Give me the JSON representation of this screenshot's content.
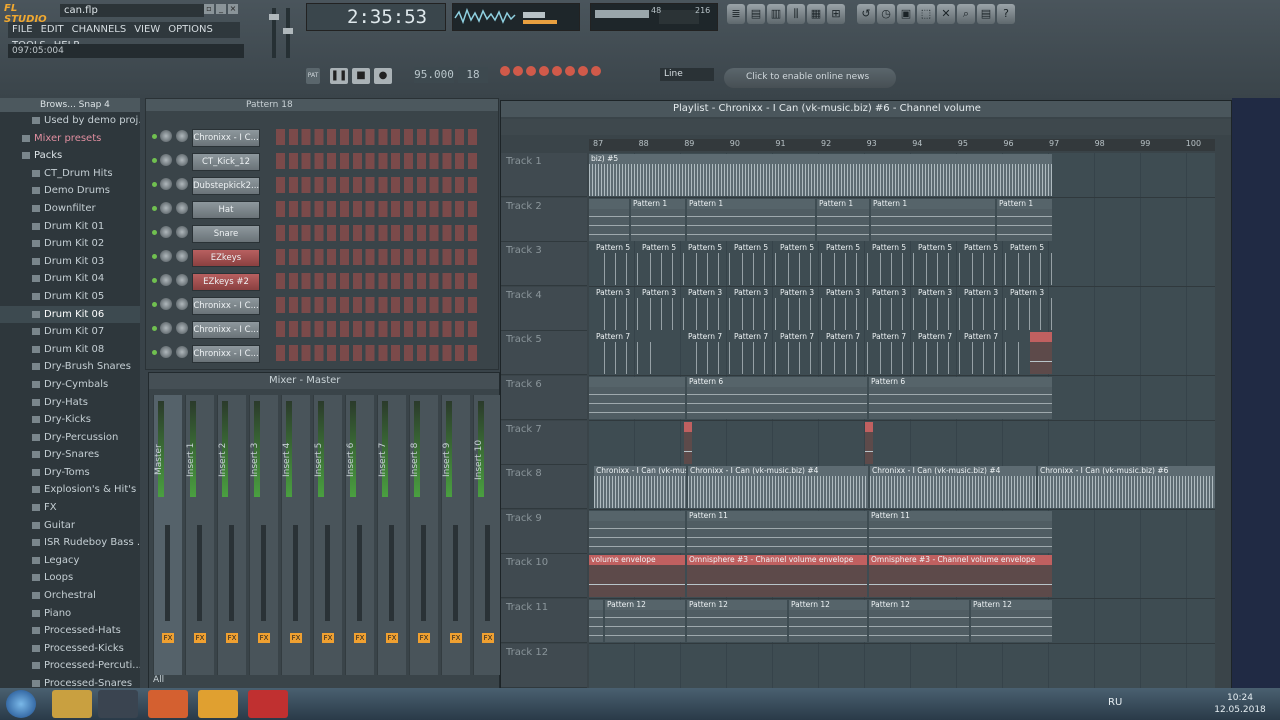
{
  "app": {
    "logo_text": "FL STUDIO",
    "file_name": "can.flp"
  },
  "menu": [
    "FILE",
    "EDIT",
    "CHANNELS",
    "VIEW",
    "OPTIONS",
    "TOOLS",
    "HELP"
  ],
  "hint_text": "097:05:004",
  "time_display": "2:35:53",
  "tempo": "95.000",
  "pattern_number": "18",
  "cpu_readout": {
    "cpu": "48",
    "poly": "216"
  },
  "snap_mode": "Line",
  "online_text": "Click to enable online news",
  "browser": {
    "title": "Brows... Snap 4",
    "items": [
      {
        "label": "Used by demo proj...",
        "kind": "item"
      },
      {
        "label": "Mixer presets",
        "kind": "mix"
      },
      {
        "label": "Packs",
        "kind": "packs"
      },
      {
        "label": "CT_Drum Hits",
        "kind": "item"
      },
      {
        "label": "Demo Drums",
        "kind": "item"
      },
      {
        "label": "Downfilter",
        "kind": "item"
      },
      {
        "label": "Drum Kit 01",
        "kind": "item"
      },
      {
        "label": "Drum Kit 02",
        "kind": "item"
      },
      {
        "label": "Drum Kit 03",
        "kind": "item"
      },
      {
        "label": "Drum Kit 04",
        "kind": "item"
      },
      {
        "label": "Drum Kit 05",
        "kind": "item"
      },
      {
        "label": "Drum Kit 06",
        "kind": "sel"
      },
      {
        "label": "Drum Kit 07",
        "kind": "item"
      },
      {
        "label": "Drum Kit 08",
        "kind": "item"
      },
      {
        "label": "Dry-Brush Snares",
        "kind": "item"
      },
      {
        "label": "Dry-Cymbals",
        "kind": "item"
      },
      {
        "label": "Dry-Hats",
        "kind": "item"
      },
      {
        "label": "Dry-Kicks",
        "kind": "item"
      },
      {
        "label": "Dry-Percussion",
        "kind": "item"
      },
      {
        "label": "Dry-Snares",
        "kind": "item"
      },
      {
        "label": "Dry-Toms",
        "kind": "item"
      },
      {
        "label": "Explosion's & Hit's",
        "kind": "item"
      },
      {
        "label": "FX",
        "kind": "item"
      },
      {
        "label": "Guitar",
        "kind": "item"
      },
      {
        "label": "ISR Rudeboy Bass ...",
        "kind": "item"
      },
      {
        "label": "Legacy",
        "kind": "item"
      },
      {
        "label": "Loops",
        "kind": "item"
      },
      {
        "label": "Orchestral",
        "kind": "item"
      },
      {
        "label": "Piano",
        "kind": "item"
      },
      {
        "label": "Processed-Hats",
        "kind": "item"
      },
      {
        "label": "Processed-Kicks",
        "kind": "item"
      },
      {
        "label": "Processed-Percuti...",
        "kind": "item"
      },
      {
        "label": "Processed-Snares",
        "kind": "item"
      }
    ]
  },
  "channel_rack": {
    "title": "Pattern 18",
    "channels": [
      {
        "name": "Chronixx - I C...",
        "color": "grey"
      },
      {
        "name": "CT_Kick_12",
        "color": "grey"
      },
      {
        "name": "Dubstepkick2...",
        "color": "grey"
      },
      {
        "name": "Hat",
        "color": "grey"
      },
      {
        "name": "Snare",
        "color": "grey"
      },
      {
        "name": "EZkeys",
        "color": "red"
      },
      {
        "name": "EZkeys #2",
        "color": "red"
      },
      {
        "name": "Chronixx - I C...",
        "color": "grey"
      },
      {
        "name": "Chronixx - I C...",
        "color": "grey"
      },
      {
        "name": "Chronixx - I C...",
        "color": "grey"
      }
    ]
  },
  "mixer": {
    "title": "Mixer - Master",
    "filter": "All",
    "strips": [
      "Master",
      "Insert 1",
      "Insert 2",
      "Insert 3",
      "Insert 4",
      "Insert 5",
      "Insert 6",
      "Insert 7",
      "Insert 8",
      "Insert 9",
      "Insert 10"
    ],
    "fx_label": "FX"
  },
  "playlist": {
    "title": "Playlist - Chronixx - I Can (vk-music.biz) #6 - Channel volume",
    "ruler": [
      "87",
      "88",
      "89",
      "90",
      "91",
      "92",
      "93",
      "94",
      "95",
      "96",
      "97",
      "98",
      "99",
      "100"
    ],
    "tracks": [
      {
        "name": "Track 1",
        "clips": [
          {
            "start": 0,
            "len": 463,
            "type": "audio",
            "label": "biz) #5"
          }
        ]
      },
      {
        "name": "Track 2",
        "clips": [
          {
            "start": 0,
            "len": 40,
            "type": "pat",
            "label": ""
          },
          {
            "start": 42,
            "len": 54,
            "type": "pat",
            "label": "Pattern 1"
          },
          {
            "start": 98,
            "len": 128,
            "type": "pat",
            "label": "Pattern 1"
          },
          {
            "start": 228,
            "len": 52,
            "type": "pat",
            "label": "Pattern 1"
          },
          {
            "start": 282,
            "len": 124,
            "type": "pat",
            "label": "Pattern 1"
          },
          {
            "start": 408,
            "len": 55,
            "type": "pat",
            "label": "Pattern 1"
          }
        ]
      },
      {
        "name": "Track 3",
        "clips": [
          {
            "start": 5,
            "len": 44,
            "type": "pat2",
            "label": "Pattern 5"
          },
          {
            "start": 51,
            "len": 44,
            "type": "pat2",
            "label": "Pattern 5"
          },
          {
            "start": 97,
            "len": 44,
            "type": "pat2",
            "label": "Pattern 5"
          },
          {
            "start": 143,
            "len": 44,
            "type": "pat2",
            "label": "Pattern 5"
          },
          {
            "start": 189,
            "len": 44,
            "type": "pat2",
            "label": "Pattern 5"
          },
          {
            "start": 235,
            "len": 44,
            "type": "pat2",
            "label": "Pattern 5"
          },
          {
            "start": 281,
            "len": 44,
            "type": "pat2",
            "label": "Pattern 5"
          },
          {
            "start": 327,
            "len": 44,
            "type": "pat2",
            "label": "Pattern 5"
          },
          {
            "start": 373,
            "len": 44,
            "type": "pat2",
            "label": "Pattern 5"
          },
          {
            "start": 419,
            "len": 44,
            "type": "pat2",
            "label": "Pattern 5"
          }
        ]
      },
      {
        "name": "Track 4",
        "clips": [
          {
            "start": 5,
            "len": 44,
            "type": "pat2",
            "label": "Pattern 3"
          },
          {
            "start": 51,
            "len": 44,
            "type": "pat2",
            "label": "Pattern 3"
          },
          {
            "start": 97,
            "len": 44,
            "type": "pat2",
            "label": "Pattern 3"
          },
          {
            "start": 143,
            "len": 44,
            "type": "pat2",
            "label": "Pattern 3"
          },
          {
            "start": 189,
            "len": 44,
            "type": "pat2",
            "label": "Pattern 3"
          },
          {
            "start": 235,
            "len": 44,
            "type": "pat2",
            "label": "Pattern 3"
          },
          {
            "start": 281,
            "len": 44,
            "type": "pat2",
            "label": "Pattern 3"
          },
          {
            "start": 327,
            "len": 44,
            "type": "pat2",
            "label": "Pattern 3"
          },
          {
            "start": 373,
            "len": 44,
            "type": "pat2",
            "label": "Pattern 3"
          },
          {
            "start": 419,
            "len": 44,
            "type": "pat2",
            "label": "Pattern 3"
          }
        ]
      },
      {
        "name": "Track 5",
        "clips": [
          {
            "start": 5,
            "len": 44,
            "type": "pat2",
            "label": "Pattern 7"
          },
          {
            "start": 51,
            "len": 20,
            "type": "pat2",
            "label": ""
          },
          {
            "start": 97,
            "len": 44,
            "type": "pat2",
            "label": "Pattern 7"
          },
          {
            "start": 143,
            "len": 44,
            "type": "pat2",
            "label": "Pattern 7"
          },
          {
            "start": 189,
            "len": 44,
            "type": "pat2",
            "label": "Pattern 7"
          },
          {
            "start": 235,
            "len": 44,
            "type": "pat2",
            "label": "Pattern 7"
          },
          {
            "start": 281,
            "len": 44,
            "type": "pat2",
            "label": "Pattern 7"
          },
          {
            "start": 327,
            "len": 44,
            "type": "pat2",
            "label": "Pattern 7"
          },
          {
            "start": 373,
            "len": 44,
            "type": "pat2",
            "label": "Pattern 7"
          },
          {
            "start": 419,
            "len": 20,
            "type": "pat2",
            "label": ""
          },
          {
            "start": 441,
            "len": 22,
            "type": "env",
            "label": ""
          }
        ]
      },
      {
        "name": "Track 6",
        "clips": [
          {
            "start": 0,
            "len": 96,
            "type": "pat",
            "label": ""
          },
          {
            "start": 98,
            "len": 180,
            "type": "pat",
            "label": "Pattern 6"
          },
          {
            "start": 280,
            "len": 183,
            "type": "pat",
            "label": "Pattern 6"
          }
        ]
      },
      {
        "name": "Track 7",
        "clips": [
          {
            "start": 95,
            "len": 8,
            "type": "env",
            "label": ""
          },
          {
            "start": 276,
            "len": 8,
            "type": "env",
            "label": ""
          }
        ]
      },
      {
        "name": "Track 8",
        "clips": [
          {
            "start": 5,
            "len": 92,
            "type": "audio",
            "label": "Chronixx - I Can (vk-music..."
          },
          {
            "start": 99,
            "len": 180,
            "type": "audio",
            "label": "Chronixx - I Can (vk-music.biz) #4"
          },
          {
            "start": 281,
            "len": 166,
            "type": "audio",
            "label": "Chronixx - I Can (vk-music.biz) #4"
          },
          {
            "start": 449,
            "len": 177,
            "type": "audio",
            "label": "Chronixx - I Can (vk-music.biz) #6"
          }
        ]
      },
      {
        "name": "Track 9",
        "clips": [
          {
            "start": 0,
            "len": 96,
            "type": "pat",
            "label": ""
          },
          {
            "start": 98,
            "len": 180,
            "type": "pat",
            "label": "Pattern 11"
          },
          {
            "start": 280,
            "len": 183,
            "type": "pat",
            "label": "Pattern 11"
          }
        ]
      },
      {
        "name": "Track 10",
        "clips": [
          {
            "start": 0,
            "len": 96,
            "type": "env",
            "label": "volume envelope"
          },
          {
            "start": 98,
            "len": 180,
            "type": "env",
            "label": "Omnisphere #3 - Channel volume envelope"
          },
          {
            "start": 280,
            "len": 183,
            "type": "env",
            "label": "Omnisphere #3 - Channel volume envelope"
          }
        ]
      },
      {
        "name": "Track 11",
        "clips": [
          {
            "start": 0,
            "len": 14,
            "type": "pat",
            "label": ""
          },
          {
            "start": 16,
            "len": 80,
            "type": "pat",
            "label": "Pattern 12"
          },
          {
            "start": 98,
            "len": 100,
            "type": "pat",
            "label": "Pattern 12"
          },
          {
            "start": 200,
            "len": 78,
            "type": "pat",
            "label": "Pattern 12"
          },
          {
            "start": 280,
            "len": 100,
            "type": "pat",
            "label": "Pattern 12"
          },
          {
            "start": 382,
            "len": 81,
            "type": "pat",
            "label": "Pattern 12"
          }
        ]
      },
      {
        "name": "Track 12",
        "clips": []
      }
    ]
  },
  "taskbar": {
    "lang": "RU",
    "time": "10:24",
    "date": "12.05.2018"
  }
}
